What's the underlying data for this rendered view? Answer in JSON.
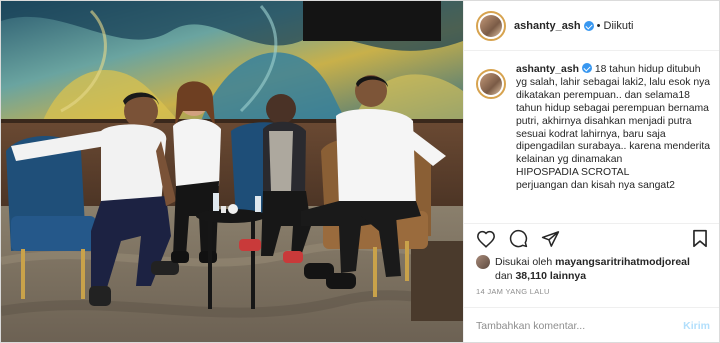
{
  "post": {
    "photo_alt": "",
    "header": {
      "username": "ashanty_ash",
      "separator": "•",
      "follow_state": "Diikuti"
    },
    "caption": {
      "username": "ashanty_ash",
      "text": " 18 tahun hidup ditubuh yg salah, lahir sebagai laki2, lalu esok nya dikatakan perempuan.. dan selama18 tahun hidup sebagai perempuan bernama putri, akhirnya disahkan menjadi putra sesuai kodrat lahirnya, baru saja dipengadilan surabaya.. karena menderita kelainan yg dinamakan\nHIPOSPADIA SCROTAL\nperjuangan dan kisah nya sangat2"
    },
    "actions": {
      "like_icon": "heart-icon",
      "comment_icon": "comment-icon",
      "share_icon": "paper-plane-icon",
      "save_icon": "bookmark-icon"
    },
    "likes": {
      "prefix": "Disukai oleh ",
      "liker": "mayangsaritrihatmodjoreal",
      "middle": " dan ",
      "count": "38,110",
      "suffix": " lainnya"
    },
    "timestamp": "14 JAM YANG LALU",
    "comment_box": {
      "placeholder": "Tambahkan komentar...",
      "post_label": "Kirim"
    }
  }
}
